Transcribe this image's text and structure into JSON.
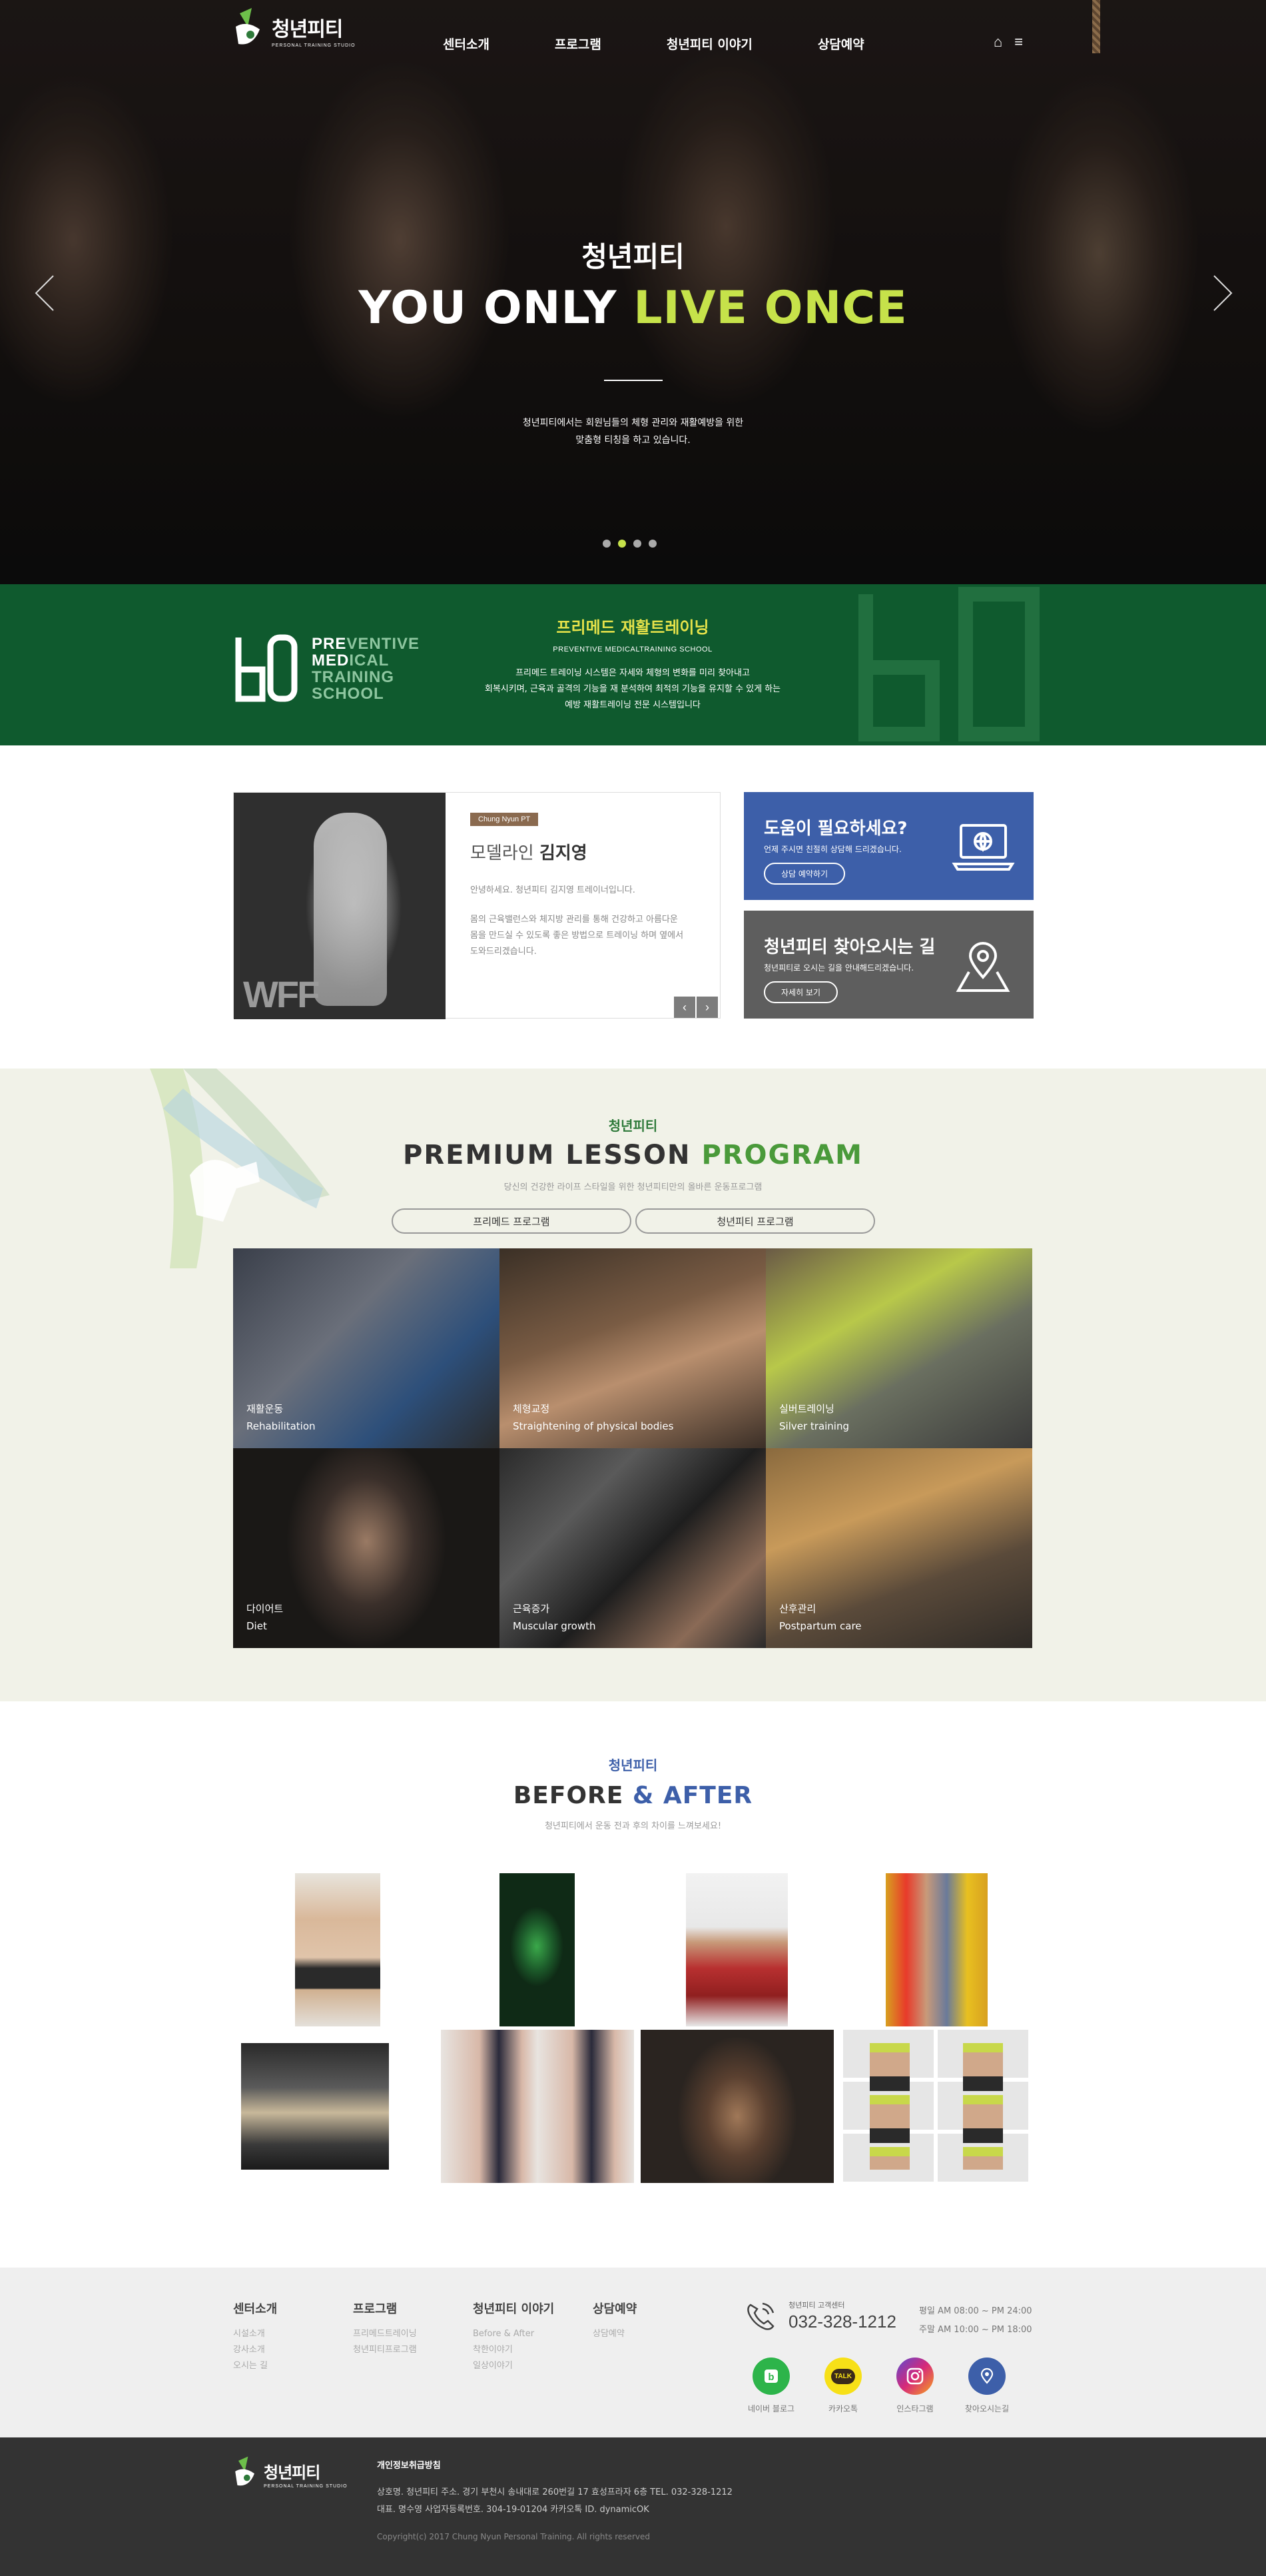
{
  "header": {
    "logo_text": "청년피티",
    "logo_sub": "PERSONAL TRAINING STUDIO",
    "nav": [
      "센터소개",
      "프로그램",
      "청년피티 이야기",
      "상담예약"
    ]
  },
  "hero": {
    "subtitle": "청년피티",
    "title_a": "YOU ONLY ",
    "title_b": "LIVE ONCE",
    "desc1": "청년피티에서는 회원님들의 체형 관리와 재활예방을 위한",
    "desc2": "맞춤형 티칭을 하고 있습니다.",
    "slide_count": 4,
    "active_slide": 2
  },
  "preventive": {
    "logo_lines": [
      {
        "bold": "PRE",
        "rest": "VENTIVE"
      },
      {
        "bold": "MED",
        "rest": "ICAL"
      },
      {
        "bold": "",
        "rest": "TRAINING"
      },
      {
        "bold": "",
        "rest": "SCHOOL"
      }
    ],
    "title": "프리메드 재활트레이닝",
    "sub": "PREVENTIVE MEDICALTRAINING SCHOOL",
    "desc1": "프리메드 트레이닝 시스템은 자세와 체형의 변화를 미리 찾아내고",
    "desc2": "회복시키며, 근육과 골격의 기능을 재 분석하여 최적의 기능을 유지할 수 있게 하는",
    "desc3": "예방 재활트레이닝 전문 시스템입니다"
  },
  "trainer": {
    "badge": "Chung Nyun PT",
    "role": "모델라인 ",
    "name": "김지영",
    "desc1": "안녕하세요. 청년피티 김지영 트레이너입니다.",
    "desc2": "몸의 근육밸런스와 체지방 관리를 통해 건강하고 아름다운",
    "desc3": "몸을 만드실 수 있도록 좋은 방법으로 트레이닝 하며 옆에서",
    "desc4": "도와드리겠습니다.",
    "prev": "‹",
    "next": "›"
  },
  "help": {
    "title": "도움이 필요하세요?",
    "desc": "언제 주시면 친절히 상담해 드리겠습니다.",
    "button": "상담 예약하기"
  },
  "find": {
    "title": "청년피티 찾아오시는 길",
    "desc": "청년피티로 오시는 길을 안내해드리겠습니다.",
    "button": "자세히 보기"
  },
  "program": {
    "small": "청년피티",
    "big_a": "PREMIUM LESSON ",
    "big_b": "PROGRAM",
    "desc": "당신의 건강한 라이프 스타일을 위한 청년피티만의 올바른 운동프로그램",
    "tabs": [
      "프리메드 프로그램",
      "청년피티 프로그램"
    ],
    "items": [
      {
        "ko": "재활운동",
        "en": "Rehabilitation"
      },
      {
        "ko": "체형교정",
        "en": "Straightening of physical bodies"
      },
      {
        "ko": "실버트레이닝",
        "en": "Silver training"
      },
      {
        "ko": "다이어트",
        "en": "Diet"
      },
      {
        "ko": "근육증가",
        "en": "Muscular growth"
      },
      {
        "ko": "산후관리",
        "en": "Postpartum care"
      }
    ]
  },
  "before_after": {
    "small": "청년피티",
    "big_a": "BEFORE ",
    "big_b": "& AFTER",
    "desc": "청년피티에서 운동 전과 후의 차이를 느껴보세요!"
  },
  "footer": {
    "cols": [
      {
        "title": "센터소개",
        "items": [
          "시설소개",
          "강사소개",
          "오시는 길"
        ]
      },
      {
        "title": "프로그램",
        "items": [
          "프리메드트레이닝",
          "청년피티프로그램"
        ]
      },
      {
        "title": "청년피티 이야기",
        "items": [
          "Before & After",
          "착한이야기",
          "일상이야기"
        ]
      },
      {
        "title": "상담예약",
        "items": [
          "상담예약"
        ]
      }
    ],
    "cs_label": "청년피티 고객센터",
    "cs_number": "032-328-1212",
    "hours1": "평일 AM 08:00 ~ PM 24:00",
    "hours2": "주말 AM 10:00 ~ PM 18:00",
    "sns": [
      "네이버 블로그",
      "카카오톡",
      "인스타그램",
      "찾아오시는길"
    ],
    "kakao_text": "TALK",
    "privacy": "개인정보취급방침",
    "addr1": "상호명. 청년피티   주소. 경기 부천시 송내대로 260번길 17 효성프라자 6층   TEL. 032-328-1212",
    "addr2": "대표. 명수영   사업자등록번호. 304-19-01204   카카오톡 ID. dynamicOK",
    "copyright": "Copyright(c) 2017 Chung Nyun Personal Training. All rights reserved"
  },
  "colors": {
    "accent_green": "#0f5a2e",
    "lime": "#c6e24a",
    "blue": "#3d5fa9",
    "gray": "#5e5e5e"
  }
}
